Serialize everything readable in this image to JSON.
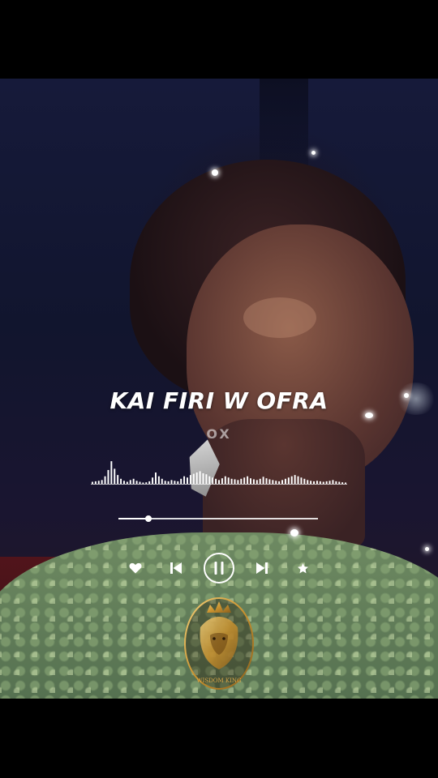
{
  "video": {
    "background_colors": {
      "backdrop": "#161a3a",
      "stage_red": "#5a1418",
      "dress": "#6e8a62",
      "skin": "#8a5a48"
    }
  },
  "song": {
    "title": "KAI FIRI W   OFRA",
    "artist": "   OX"
  },
  "waveform": {
    "amplitudes": [
      0.08,
      0.1,
      0.12,
      0.15,
      0.3,
      0.55,
      0.9,
      0.6,
      0.35,
      0.2,
      0.12,
      0.08,
      0.15,
      0.2,
      0.12,
      0.08,
      0.05,
      0.06,
      0.1,
      0.25,
      0.45,
      0.3,
      0.2,
      0.12,
      0.1,
      0.15,
      0.12,
      0.1,
      0.2,
      0.3,
      0.25,
      0.35,
      0.4,
      0.45,
      0.5,
      0.42,
      0.38,
      0.3,
      0.25,
      0.2,
      0.15,
      0.22,
      0.3,
      0.25,
      0.2,
      0.18,
      0.15,
      0.2,
      0.25,
      0.3,
      0.22,
      0.18,
      0.15,
      0.2,
      0.28,
      0.22,
      0.18,
      0.15,
      0.12,
      0.1,
      0.15,
      0.2,
      0.25,
      0.3,
      0.35,
      0.3,
      0.25,
      0.2,
      0.15,
      0.12,
      0.1,
      0.12,
      0.1,
      0.08,
      0.1,
      0.12,
      0.15,
      0.1,
      0.08,
      0.06,
      0.05
    ],
    "color": "#ffffff"
  },
  "progress": {
    "fraction": 0.15
  },
  "controls": {
    "like": "heart-icon",
    "previous": "skip-previous-icon",
    "play_pause": "pause-icon",
    "next": "skip-next-icon",
    "favorite": "star-icon"
  },
  "logo": {
    "text": "WISDOM KING",
    "color": "#d9a84a"
  }
}
